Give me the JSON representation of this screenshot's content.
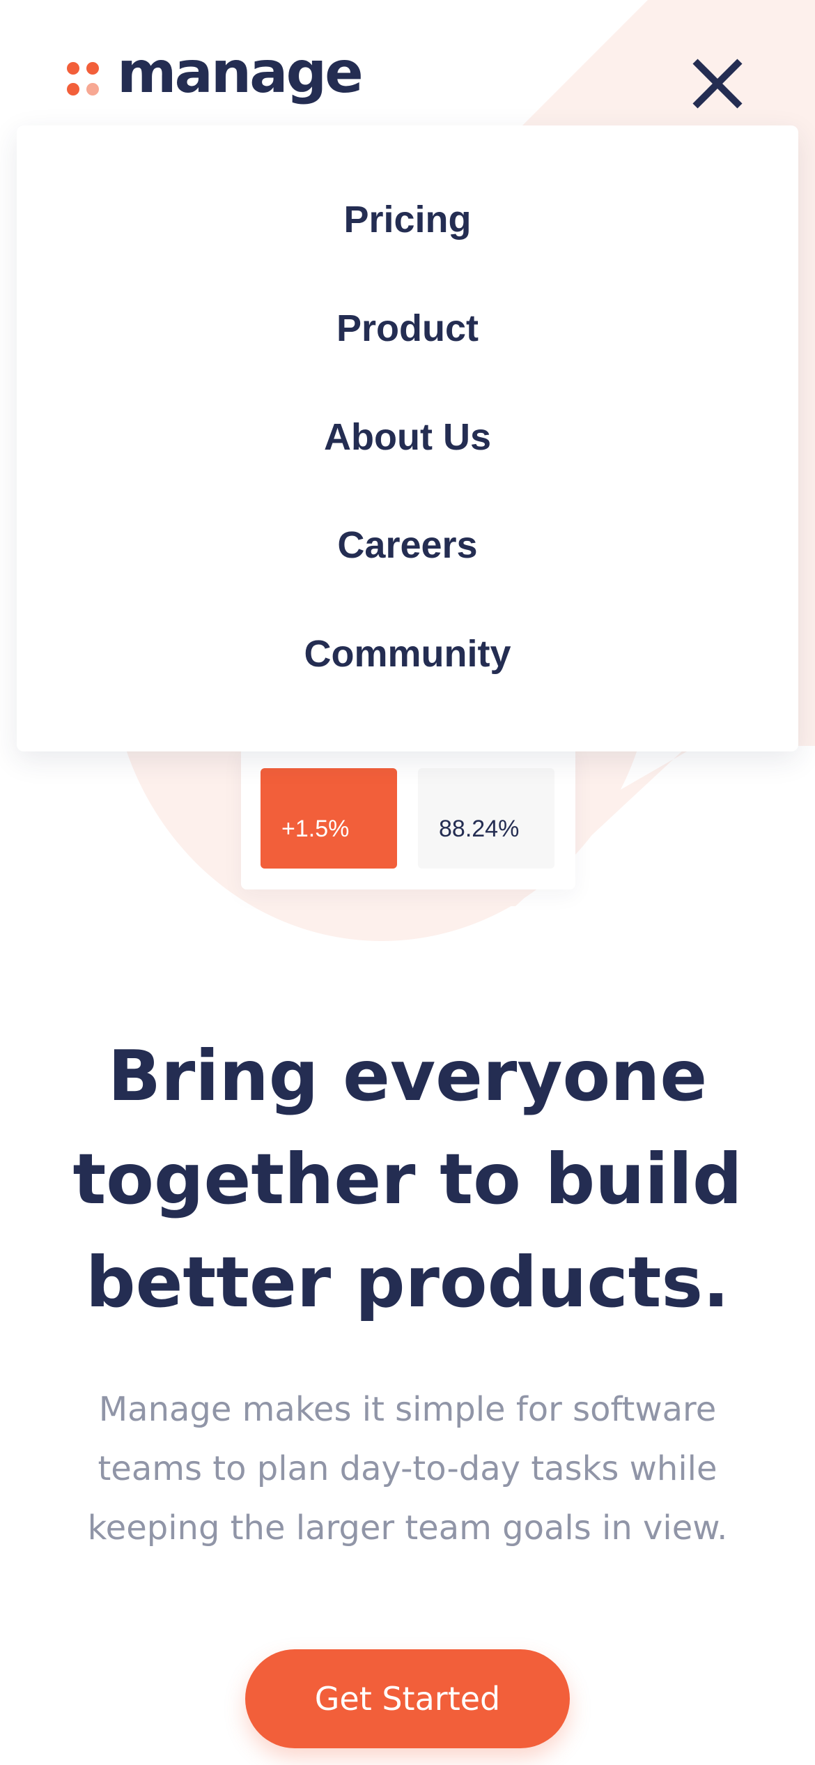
{
  "brand": {
    "name": "manage",
    "dot_colors": [
      "#f25f3a",
      "#f25f3a",
      "#f25f3a",
      "#f7a893"
    ]
  },
  "nav": {
    "close_icon": "close-icon",
    "items": [
      {
        "label": "Pricing"
      },
      {
        "label": "Product"
      },
      {
        "label": "About Us"
      },
      {
        "label": "Careers"
      },
      {
        "label": "Community"
      }
    ]
  },
  "stats": {
    "growth": "+1.5%",
    "rate": "88.24%"
  },
  "hero": {
    "headline_lines": [
      "Bring everyone",
      "together to build",
      "better products."
    ],
    "subtext_lines": [
      "Manage makes it simple for software",
      "teams to plan day-to-day tasks while",
      "keeping the larger team goals in view."
    ],
    "cta_label": "Get Started"
  },
  "colors": {
    "accent": "#f25f3a",
    "navy": "#242d52",
    "muted": "#9095a7",
    "tint": "#fdf0ec"
  }
}
